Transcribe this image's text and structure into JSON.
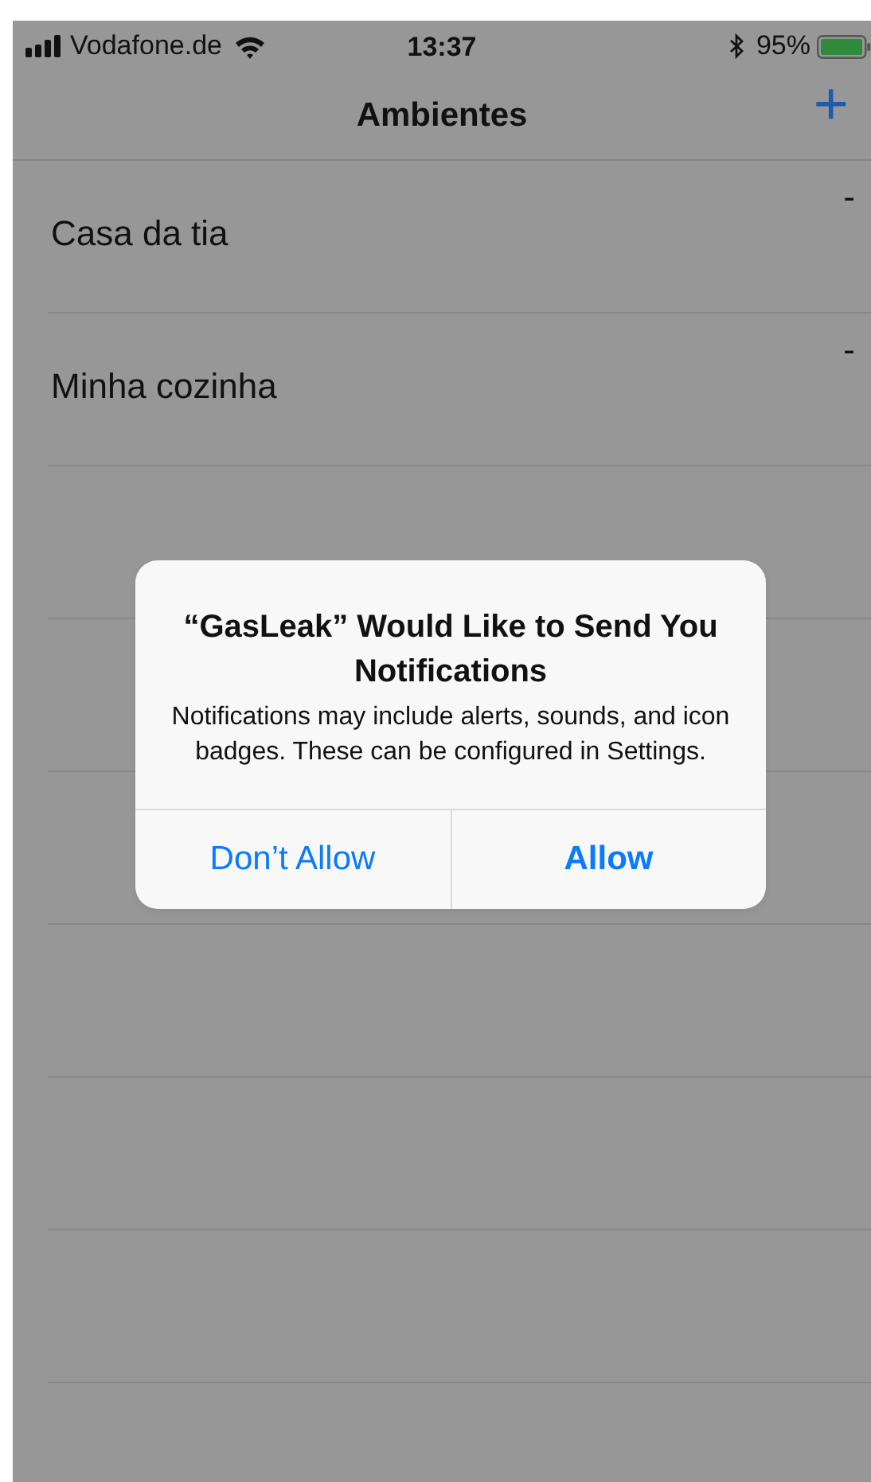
{
  "status_bar": {
    "carrier": "Vodafone.de",
    "time": "13:37",
    "battery": "95%"
  },
  "nav_bar": {
    "title": "Ambientes",
    "add_button": "+"
  },
  "rows": [
    {
      "name": "Casa da tia",
      "delete": "-"
    },
    {
      "name": "Minha cozinha",
      "delete": "-"
    }
  ],
  "alert": {
    "title": "“GasLeak” Would Like to Send You Notifications",
    "message": "Notifications may include alerts, sounds, and icon badges. These can be configured in Settings.",
    "buttons": [
      {
        "label": "Don’t Allow",
        "preferred": false
      },
      {
        "label": "Allow",
        "preferred": true
      }
    ]
  }
}
